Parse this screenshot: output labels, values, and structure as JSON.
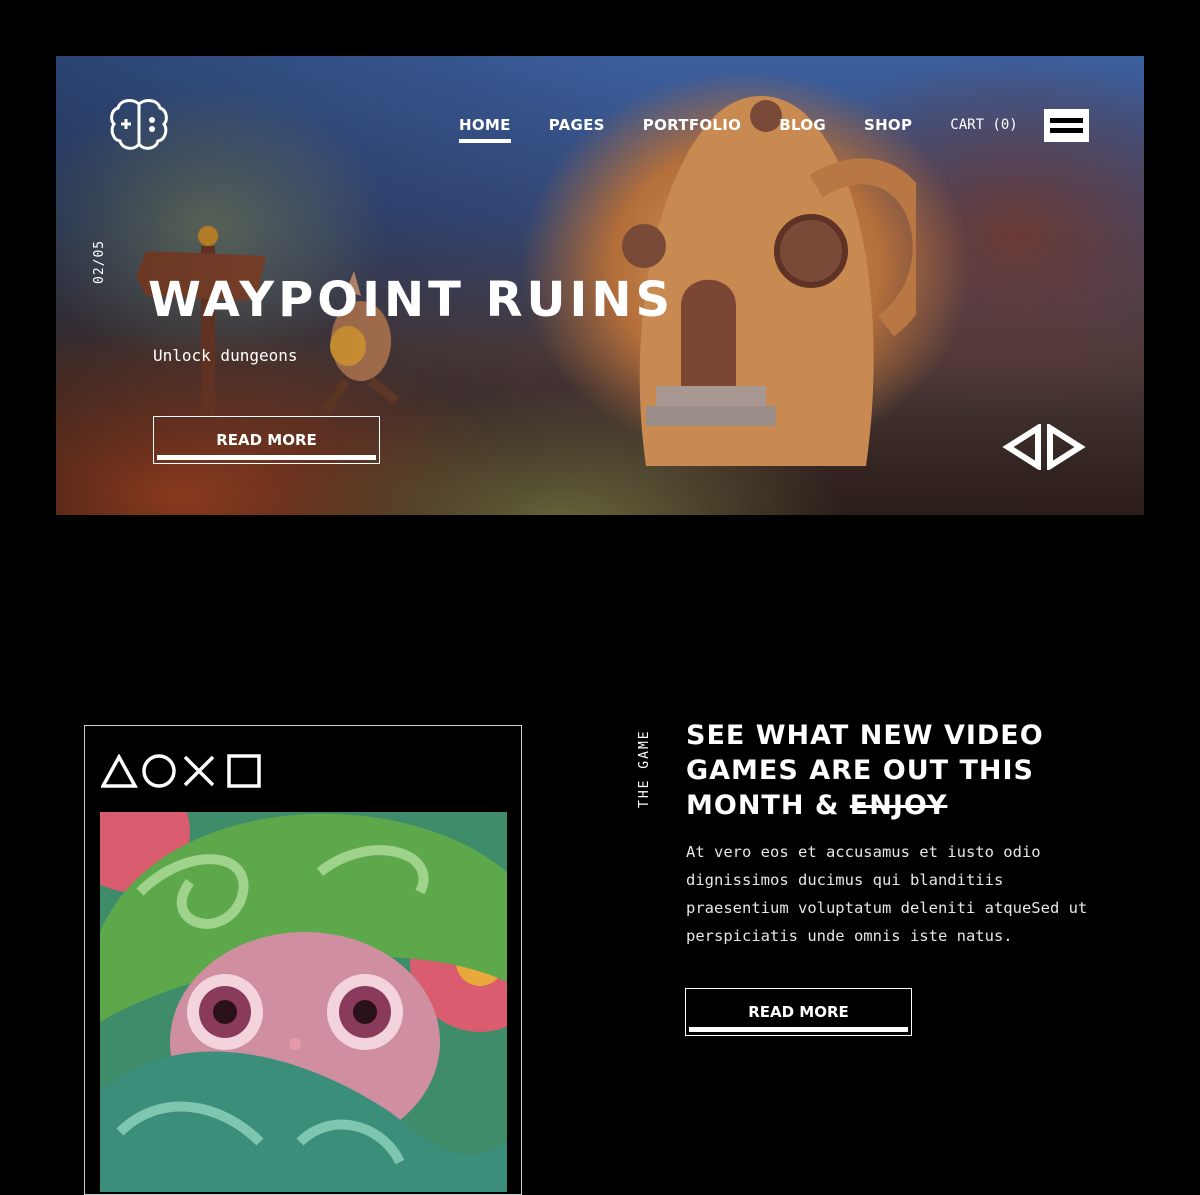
{
  "nav": {
    "items": [
      "HOME",
      "PAGES",
      "PORTFOLIO",
      "BLOG",
      "SHOP"
    ],
    "active": "HOME",
    "cart": "CART (0)"
  },
  "hero": {
    "counter": "02/05",
    "title": "WAYPOINT RUINS",
    "subtitle": "Unlock dungeons",
    "button": "READ MORE"
  },
  "section": {
    "side_label": "THE GAME",
    "heading_line1": "SEE WHAT NEW VIDEO",
    "heading_line2": "GAMES ARE OUT THIS",
    "heading_line3_prefix": "MONTH & ",
    "heading_strike": "ENJOY",
    "body": "At vero eos et accusamus et iusto odio dignissimos ducimus qui blanditiis praesentium voluptatum deleniti atqueSed ut perspiciatis unde omnis iste natus.",
    "button": "READ MORE"
  },
  "icons": {
    "logo": "brain-gamepad-logo",
    "menu": "hamburger-menu-icon",
    "prev": "prev-arrow-icon",
    "next": "next-arrow-icon",
    "symbols": "playstation-symbols"
  },
  "colors": {
    "background": "#000000",
    "text": "#ffffff"
  }
}
